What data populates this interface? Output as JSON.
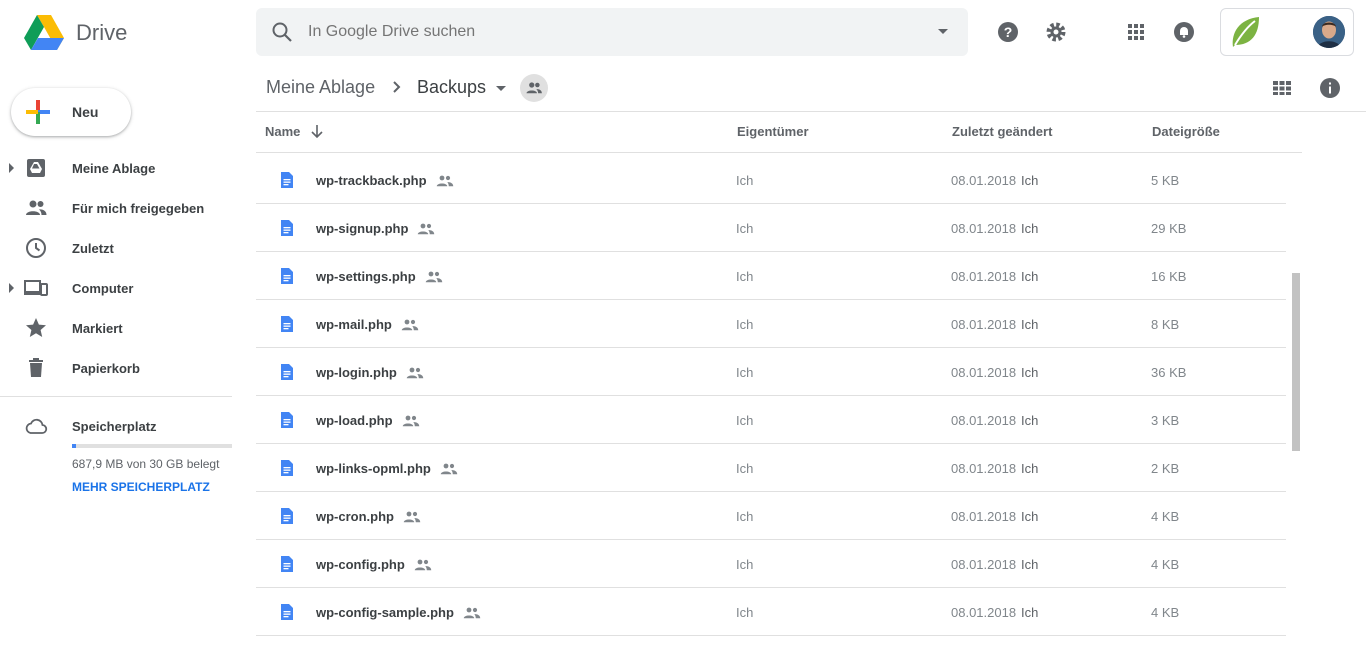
{
  "app": {
    "name": "Drive"
  },
  "search": {
    "placeholder": "In Google Drive suchen",
    "value": ""
  },
  "toolbar": {
    "icons": [
      "help-icon",
      "settings-icon",
      "apps-icon",
      "notifications-icon"
    ]
  },
  "sidebar": {
    "new_label": "Neu",
    "items": [
      {
        "label": "Meine Ablage",
        "icon": "my-drive-icon"
      },
      {
        "label": "Für mich freigegeben",
        "icon": "shared-with-me-icon"
      },
      {
        "label": "Zuletzt",
        "icon": "clock-icon"
      },
      {
        "label": "Computer",
        "icon": "computer-icon"
      },
      {
        "label": "Markiert",
        "icon": "star-icon"
      },
      {
        "label": "Papierkorb",
        "icon": "trash-icon"
      }
    ],
    "storage": {
      "label": "Speicherplatz",
      "used_text": "687,9 MB von 30 GB belegt",
      "used_fraction": 0.022,
      "upgrade_label": "MEHR SPEICHERPLATZ"
    }
  },
  "breadcrumb": {
    "root": "Meine Ablage",
    "current": "Backups"
  },
  "table": {
    "columns": {
      "name": "Name",
      "owner": "Eigentümer",
      "modified": "Zuletzt geändert",
      "size": "Dateigröße"
    },
    "rows": [
      {
        "name": "wp-trackback.php",
        "owner": "Ich",
        "date": "08.01.2018",
        "modified_by": "Ich",
        "size": "5 KB"
      },
      {
        "name": "wp-signup.php",
        "owner": "Ich",
        "date": "08.01.2018",
        "modified_by": "Ich",
        "size": "29 KB"
      },
      {
        "name": "wp-settings.php",
        "owner": "Ich",
        "date": "08.01.2018",
        "modified_by": "Ich",
        "size": "16 KB"
      },
      {
        "name": "wp-mail.php",
        "owner": "Ich",
        "date": "08.01.2018",
        "modified_by": "Ich",
        "size": "8 KB"
      },
      {
        "name": "wp-login.php",
        "owner": "Ich",
        "date": "08.01.2018",
        "modified_by": "Ich",
        "size": "36 KB"
      },
      {
        "name": "wp-load.php",
        "owner": "Ich",
        "date": "08.01.2018",
        "modified_by": "Ich",
        "size": "3 KB"
      },
      {
        "name": "wp-links-opml.php",
        "owner": "Ich",
        "date": "08.01.2018",
        "modified_by": "Ich",
        "size": "2 KB"
      },
      {
        "name": "wp-cron.php",
        "owner": "Ich",
        "date": "08.01.2018",
        "modified_by": "Ich",
        "size": "4 KB"
      },
      {
        "name": "wp-config.php",
        "owner": "Ich",
        "date": "08.01.2018",
        "modified_by": "Ich",
        "size": "4 KB"
      },
      {
        "name": "wp-config-sample.php",
        "owner": "Ich",
        "date": "08.01.2018",
        "modified_by": "Ich",
        "size": "4 KB"
      }
    ]
  },
  "colors": {
    "accent": "#4285f4",
    "link": "#1a73e8",
    "file_icon": "#4285f4",
    "icon_grey": "#5f6368"
  }
}
